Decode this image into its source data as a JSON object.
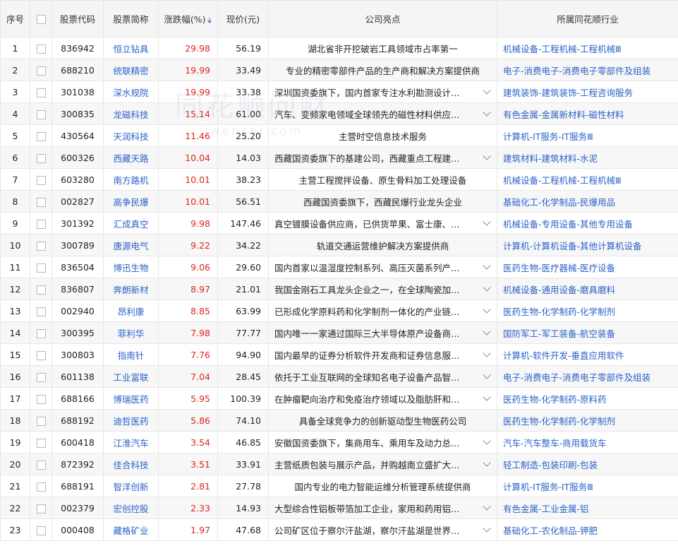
{
  "headers": {
    "seq": "序号",
    "code": "股票代码",
    "name": "股票简称",
    "change": "涨跌幅(%)",
    "price": "现价(元)",
    "highlight": "公司亮点",
    "industry": "所属同花顺行业"
  },
  "watermark": {
    "main": "同花顺问财",
    "sub": "iwencai.com"
  },
  "colors": {
    "link": "#2b62c9",
    "up": "#e0241b"
  },
  "rows": [
    {
      "seq": "1",
      "code": "836942",
      "name": "恒立钻具",
      "change": "29.98",
      "price": "56.19",
      "highlight": "湖北省非开挖破岩工具领域市占率第一",
      "truncated": false,
      "industry": "机械设备-工程机械-工程机械Ⅲ"
    },
    {
      "seq": "2",
      "code": "688210",
      "name": "统联精密",
      "change": "19.99",
      "price": "33.49",
      "highlight": "专业的精密零部件产品的生产商和解决方案提供商",
      "truncated": false,
      "industry": "电子-消费电子-消费电子零部件及组装"
    },
    {
      "seq": "3",
      "code": "301038",
      "name": "深水规院",
      "change": "19.99",
      "price": "33.38",
      "highlight": "深圳国资委旗下，国内首家专注水利勘测设计…",
      "truncated": true,
      "industry": "建筑装饰-建筑装饰-工程咨询服务"
    },
    {
      "seq": "4",
      "code": "300835",
      "name": "龙磁科技",
      "change": "15.14",
      "price": "61.00",
      "highlight": "汽车、变频家电领域全球领先的磁性材料供应…",
      "truncated": true,
      "industry": "有色金属-金属新材料-磁性材料"
    },
    {
      "seq": "5",
      "code": "430564",
      "name": "天润科技",
      "change": "11.46",
      "price": "25.20",
      "highlight": "主营时空信息技术服务",
      "truncated": false,
      "industry": "计算机-IT服务-IT服务Ⅲ"
    },
    {
      "seq": "6",
      "code": "600326",
      "name": "西藏天路",
      "change": "10.04",
      "price": "14.03",
      "highlight": "西藏国资委旗下的基建公司，西藏重点工程建…",
      "truncated": true,
      "industry": "建筑材料-建筑材料-水泥"
    },
    {
      "seq": "7",
      "code": "603280",
      "name": "南方路机",
      "change": "10.01",
      "price": "38.23",
      "highlight": "主营工程搅拌设备、原生骨料加工处理设备",
      "truncated": false,
      "industry": "机械设备-工程机械-工程机械Ⅲ"
    },
    {
      "seq": "8",
      "code": "002827",
      "name": "高争民爆",
      "change": "10.01",
      "price": "56.51",
      "highlight": "西藏国资委旗下，西藏民爆行业龙头企业",
      "truncated": false,
      "industry": "基础化工-化学制品-民爆用品"
    },
    {
      "seq": "9",
      "code": "301392",
      "name": "汇成真空",
      "change": "9.98",
      "price": "147.46",
      "highlight": "真空镀膜设备供应商，已供货苹果、富士康、…",
      "truncated": true,
      "industry": "机械设备-专用设备-其他专用设备"
    },
    {
      "seq": "10",
      "code": "300789",
      "name": "唐源电气",
      "change": "9.22",
      "price": "34.22",
      "highlight": "轨道交通运营维护解决方案提供商",
      "truncated": false,
      "industry": "计算机-计算机设备-其他计算机设备"
    },
    {
      "seq": "11",
      "code": "836504",
      "name": "博迅生物",
      "change": "9.06",
      "price": "29.60",
      "highlight": "国内首家以温湿度控制系列、高压灭菌系列产…",
      "truncated": true,
      "industry": "医药生物-医疗器械-医疗设备"
    },
    {
      "seq": "12",
      "code": "836807",
      "name": "奔朗新材",
      "change": "8.97",
      "price": "21.01",
      "highlight": "我国金刚石工具龙头企业之一，在全球陶瓷加…",
      "truncated": true,
      "industry": "机械设备-通用设备-磨具磨料"
    },
    {
      "seq": "13",
      "code": "002940",
      "name": "昂利康",
      "change": "8.85",
      "price": "63.99",
      "highlight": "已形成化学原料药和化学制剂一体化的产业链…",
      "truncated": true,
      "industry": "医药生物-化学制药-化学制剂"
    },
    {
      "seq": "14",
      "code": "300395",
      "name": "菲利华",
      "change": "7.98",
      "price": "77.77",
      "highlight": "国内唯一一家通过国际三大半导体原产设备商…",
      "truncated": true,
      "industry": "国防军工-军工装备-航空装备"
    },
    {
      "seq": "15",
      "code": "300803",
      "name": "指南针",
      "change": "7.76",
      "price": "94.90",
      "highlight": "国内最早的证券分析软件开发商和证券信息服…",
      "truncated": true,
      "industry": "计算机-软件开发-垂直应用软件"
    },
    {
      "seq": "16",
      "code": "601138",
      "name": "工业富联",
      "change": "7.04",
      "price": "28.45",
      "highlight": "依托于工业互联网的全球知名电子设备产品智…",
      "truncated": true,
      "industry": "电子-消费电子-消费电子零部件及组装"
    },
    {
      "seq": "17",
      "code": "688166",
      "name": "博瑞医药",
      "change": "5.95",
      "price": "100.39",
      "highlight": "在肿瘤靶向治疗和免疫治疗领域以及脂肪肝和…",
      "truncated": true,
      "industry": "医药生物-化学制药-原料药"
    },
    {
      "seq": "18",
      "code": "688192",
      "name": "迪哲医药",
      "change": "5.86",
      "price": "74.10",
      "highlight": "具备全球竞争力的创新驱动型生物医药公司",
      "truncated": false,
      "industry": "医药生物-化学制药-化学制剂"
    },
    {
      "seq": "19",
      "code": "600418",
      "name": "江淮汽车",
      "change": "3.54",
      "price": "46.85",
      "highlight": "安徽国资委旗下，集商用车、乘用车及动力总…",
      "truncated": true,
      "industry": "汽车-汽车整车-商用载货车"
    },
    {
      "seq": "20",
      "code": "872392",
      "name": "佳合科技",
      "change": "3.51",
      "price": "33.91",
      "highlight": "主营纸质包装与展示产品，并购越南立盛扩大…",
      "truncated": true,
      "industry": "轻工制造-包装印刷-包装"
    },
    {
      "seq": "21",
      "code": "688191",
      "name": "智洋创新",
      "change": "2.81",
      "price": "27.78",
      "highlight": "国内专业的电力智能运维分析管理系统提供商",
      "truncated": false,
      "industry": "计算机-IT服务-IT服务Ⅲ"
    },
    {
      "seq": "22",
      "code": "002379",
      "name": "宏创控股",
      "change": "2.33",
      "price": "14.93",
      "highlight": "大型综合性铝板带箔加工企业，家用和药用铝…",
      "truncated": true,
      "industry": "有色金属-工业金属-铝"
    },
    {
      "seq": "23",
      "code": "000408",
      "name": "藏格矿业",
      "change": "1.97",
      "price": "47.68",
      "highlight": "公司矿区位于察尔汗盐湖，察尔汗盐湖是世界…",
      "truncated": true,
      "industry": "基础化工-农化制品-钾肥"
    }
  ]
}
